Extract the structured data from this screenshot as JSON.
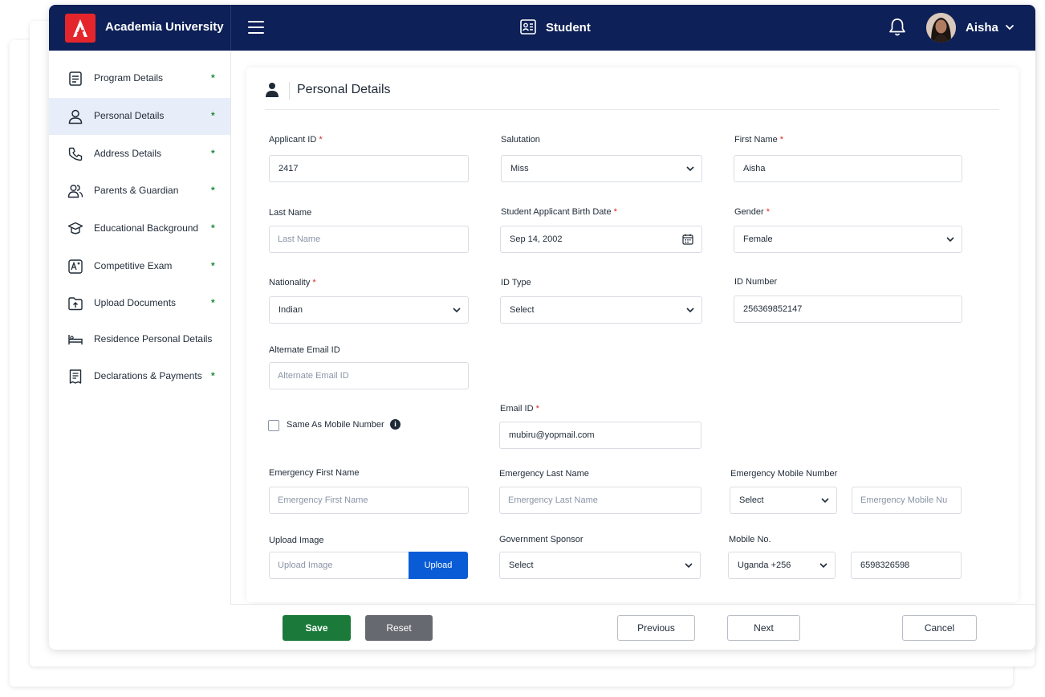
{
  "app": {
    "title": "Academia University",
    "module": "Student",
    "user_name": "Aisha"
  },
  "sidebar": {
    "items": [
      {
        "label": "Program Details",
        "dot": "*"
      },
      {
        "label": "Personal Details",
        "dot": "*"
      },
      {
        "label": "Address Details",
        "dot": "*"
      },
      {
        "label": "Parents & Guardian",
        "dot": "*"
      },
      {
        "label": "Educational Background",
        "dot": "*"
      },
      {
        "label": "Competitive Exam",
        "dot": "*"
      },
      {
        "label": "Upload Documents",
        "dot": "*"
      },
      {
        "label": "Residence Personal Details",
        "dot": ""
      },
      {
        "label": "Declarations & Payments",
        "dot": "*"
      }
    ]
  },
  "section": {
    "title": "Personal Details"
  },
  "form": {
    "applicant_id": {
      "label": "Applicant ID",
      "required": "*",
      "value": "2417"
    },
    "salutation": {
      "label": "Salutation",
      "value": "Miss"
    },
    "first_name": {
      "label": "First Name",
      "required": "*",
      "value": "Aisha"
    },
    "last_name": {
      "label": "Last Name",
      "placeholder": "Last Name"
    },
    "birth_date": {
      "label": "Student Applicant Birth Date",
      "required": "*",
      "value": "Sep 14, 2002"
    },
    "gender": {
      "label": "Gender",
      "required": "*",
      "value": "Female"
    },
    "nationality": {
      "label": "Nationality",
      "required": "*",
      "value": "Indian"
    },
    "id_type": {
      "label": "ID Type",
      "value": "Select"
    },
    "id_number": {
      "label": "ID Number",
      "value": "256369852147"
    },
    "alt_email": {
      "label": "Alternate Email ID",
      "placeholder": "Alternate Email ID"
    },
    "same_as_mobile": {
      "label": "Same As Mobile Number"
    },
    "email": {
      "label": "Email ID",
      "required": "*",
      "value": "mubiru@yopmail.com"
    },
    "emergency_first": {
      "label": "Emergency First Name",
      "placeholder": "Emergency First Name"
    },
    "emergency_last": {
      "label": "Emergency Last Name",
      "placeholder": "Emergency Last Name"
    },
    "emergency_mobile": {
      "label": "Emergency Mobile Number",
      "code_value": "Select",
      "placeholder": "Emergency Mobile Nu"
    },
    "upload_image": {
      "label": "Upload Image",
      "placeholder": "Upload Image",
      "button": "Upload"
    },
    "gov_sponsor": {
      "label": "Government Sponsor",
      "value": "Select"
    },
    "mobile": {
      "label": "Mobile No.",
      "code_value": "Uganda +256",
      "value": "6598326598"
    }
  },
  "footer": {
    "save": "Save",
    "reset": "Reset",
    "previous": "Previous",
    "next": "Next",
    "cancel": "Cancel"
  },
  "colors": {
    "topbar": "#0d2057",
    "logo": "#e4262c",
    "save": "#1b7a3a",
    "upload": "#0a5cd6",
    "active_nav": "#e8eef9",
    "required": "#e02424"
  }
}
